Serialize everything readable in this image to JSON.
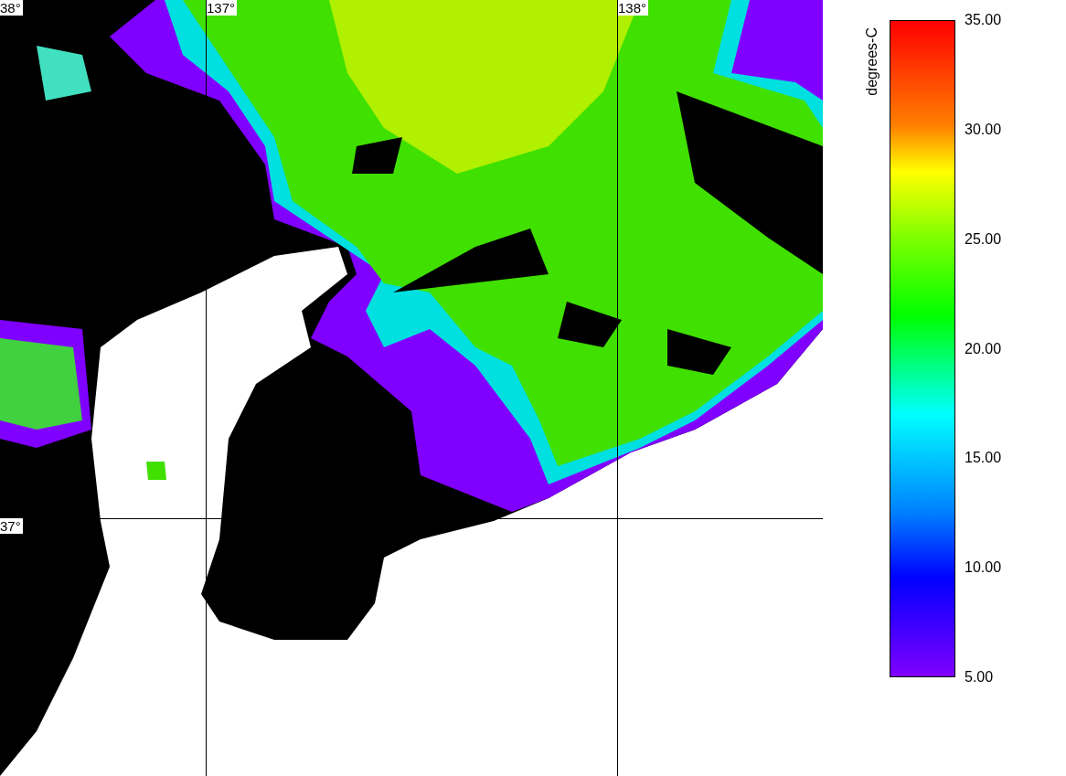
{
  "map": {
    "latitude_labels": [
      "38°",
      "37°"
    ],
    "longitude_labels": [
      "137°",
      "138°"
    ]
  },
  "colorbar": {
    "title": "degrees-C",
    "ticks": [
      "35.00",
      "30.00",
      "25.00",
      "20.00",
      "15.00",
      "10.00",
      "5.00"
    ]
  }
}
